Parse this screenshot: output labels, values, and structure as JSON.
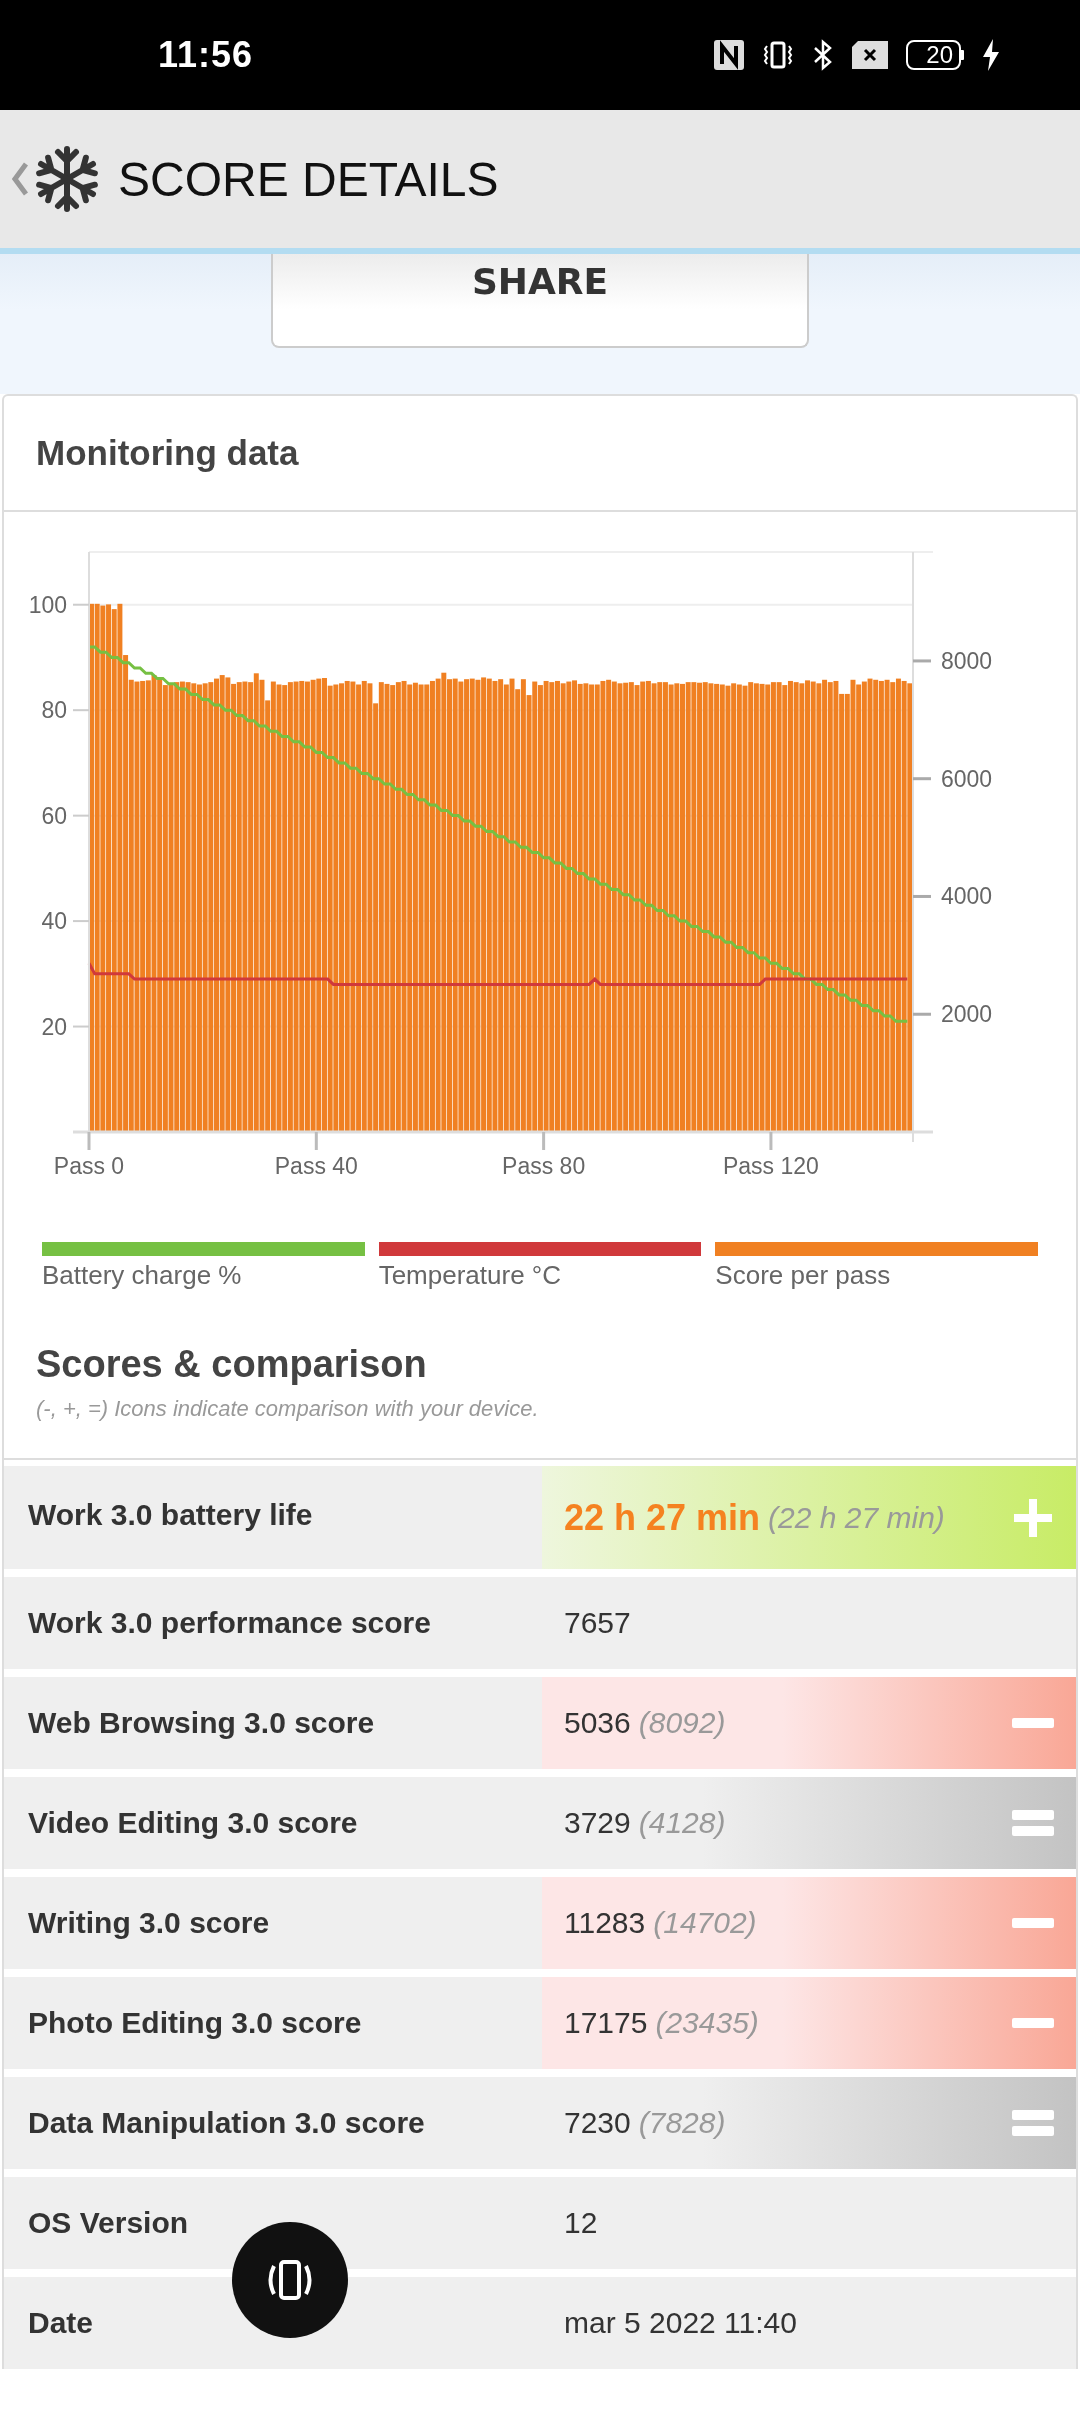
{
  "status_bar": {
    "time": "11:56",
    "battery": "20",
    "charging": true
  },
  "header": {
    "title": "SCORE DETAILS"
  },
  "share_button": {
    "label": "SHARE"
  },
  "monitoring": {
    "title": "Monitoring data",
    "chart_data": {
      "type": "bar",
      "grid": true,
      "categories": [
        "Pass 0",
        null,
        null,
        null,
        null,
        null,
        null,
        null,
        null,
        null,
        null,
        null,
        null,
        null,
        null,
        null,
        null,
        null,
        null,
        null,
        null,
        null,
        null,
        null,
        null,
        null,
        null,
        null,
        null,
        null,
        null,
        null,
        null,
        null,
        null,
        null,
        null,
        null,
        null,
        null,
        "Pass 40",
        null,
        null,
        null,
        null,
        null,
        null,
        null,
        null,
        null,
        null,
        null,
        null,
        null,
        null,
        null,
        null,
        null,
        null,
        null,
        null,
        null,
        null,
        null,
        null,
        null,
        null,
        null,
        null,
        null,
        null,
        null,
        null,
        null,
        null,
        null,
        null,
        null,
        null,
        null,
        "Pass 80",
        null,
        null,
        null,
        null,
        null,
        null,
        null,
        null,
        null,
        null,
        null,
        null,
        null,
        null,
        null,
        null,
        null,
        null,
        null,
        null,
        null,
        null,
        null,
        null,
        null,
        null,
        null,
        null,
        null,
        null,
        null,
        null,
        null,
        null,
        null,
        null,
        null,
        null,
        null,
        "Pass 120",
        null,
        null,
        null,
        null,
        null,
        null,
        null,
        null,
        null,
        null,
        null,
        null,
        null,
        null,
        null,
        null,
        null,
        null,
        null,
        null,
        null,
        null,
        null,
        null
      ],
      "ylim": [
        0,
        110
      ],
      "yticks": [
        20,
        40,
        60,
        80,
        100
      ],
      "y2lim": [
        0,
        9850
      ],
      "y2ticks": [
        2000,
        4000,
        6000,
        8000
      ],
      "series": [
        {
          "name": "Battery charge %",
          "color": "#76c043",
          "type": "line",
          "values": [
            92,
            92,
            91,
            91,
            90,
            90,
            89,
            89,
            88,
            88,
            87,
            87,
            86,
            86,
            85,
            85,
            84,
            84,
            83,
            83,
            82,
            82,
            81,
            81,
            80,
            80,
            79,
            79,
            78,
            78,
            77,
            77,
            76,
            76,
            75,
            75,
            74,
            74,
            73,
            73,
            72,
            72,
            71,
            71,
            70,
            70,
            69,
            69,
            68,
            68,
            67,
            67,
            66,
            66,
            65,
            65,
            64,
            64,
            63,
            63,
            62,
            62,
            61,
            61,
            60,
            60,
            59,
            59,
            58,
            58,
            57,
            57,
            56,
            56,
            55,
            55,
            54,
            54,
            53,
            53,
            52,
            52,
            51,
            51,
            50,
            50,
            49,
            49,
            48,
            48,
            47,
            47,
            46,
            46,
            45,
            45,
            44,
            44,
            43,
            43,
            42,
            42,
            41,
            41,
            40,
            40,
            39,
            39,
            38,
            38,
            37,
            37,
            36,
            36,
            35,
            35,
            34,
            34,
            33,
            33,
            32,
            32,
            31,
            31,
            30,
            30,
            29,
            29,
            28,
            28,
            27,
            27,
            26,
            26,
            25,
            25,
            24,
            24,
            23,
            23,
            22,
            22,
            21,
            21,
            21
          ]
        },
        {
          "name": "Temperature °C",
          "color": "#d0393b",
          "type": "line",
          "values": [
            32,
            30,
            30,
            30,
            30,
            30,
            30,
            30,
            29,
            29,
            29,
            29,
            29,
            29,
            29,
            29,
            29,
            29,
            29,
            29,
            29,
            29,
            29,
            29,
            29,
            29,
            29,
            29,
            29,
            29,
            29,
            29,
            29,
            29,
            29,
            29,
            29,
            29,
            29,
            29,
            29,
            29,
            29,
            28,
            28,
            28,
            28,
            28,
            28,
            28,
            28,
            28,
            28,
            28,
            28,
            28,
            28,
            28,
            28,
            28,
            28,
            28,
            28,
            28,
            28,
            28,
            28,
            28,
            28,
            28,
            28,
            28,
            28,
            28,
            28,
            28,
            28,
            28,
            28,
            28,
            28,
            28,
            28,
            28,
            28,
            28,
            28,
            28,
            28,
            29,
            28,
            28,
            28,
            28,
            28,
            28,
            28,
            28,
            28,
            28,
            28,
            28,
            28,
            28,
            28,
            28,
            28,
            28,
            28,
            28,
            28,
            28,
            28,
            28,
            28,
            28,
            28,
            28,
            28,
            29,
            29,
            29,
            29,
            29,
            29,
            29,
            29,
            29,
            29,
            29,
            29,
            29,
            29,
            29,
            29,
            29,
            29,
            29,
            29,
            29,
            29,
            29,
            29,
            29,
            29
          ]
        },
        {
          "name": "Score per pass",
          "color": "#f08022",
          "type": "bar",
          "axis": "y2",
          "values": [
            8970,
            8970,
            8940,
            8960,
            8880,
            8970,
            8100,
            7680,
            7650,
            7660,
            7670,
            7760,
            7710,
            7590,
            7620,
            7640,
            7650,
            7640,
            7620,
            7600,
            7620,
            7640,
            7700,
            7760,
            7720,
            7610,
            7640,
            7650,
            7640,
            7790,
            7680,
            7330,
            7650,
            7600,
            7590,
            7640,
            7650,
            7660,
            7650,
            7680,
            7700,
            7710,
            7580,
            7600,
            7620,
            7660,
            7650,
            7600,
            7660,
            7620,
            7280,
            7640,
            7610,
            7590,
            7640,
            7660,
            7600,
            7630,
            7600,
            7600,
            7660,
            7700,
            7800,
            7690,
            7700,
            7650,
            7690,
            7700,
            7680,
            7720,
            7700,
            7660,
            7690,
            7600,
            7700,
            7520,
            7690,
            7420,
            7650,
            7590,
            7660,
            7640,
            7660,
            7620,
            7650,
            7670,
            7610,
            7620,
            7600,
            7600,
            7660,
            7680,
            7650,
            7620,
            7630,
            7640,
            7590,
            7650,
            7660,
            7620,
            7640,
            7640,
            7600,
            7620,
            7610,
            7640,
            7640,
            7630,
            7640,
            7620,
            7610,
            7600,
            7580,
            7620,
            7600,
            7580,
            7640,
            7620,
            7610,
            7600,
            7640,
            7640,
            7590,
            7660,
            7640,
            7620,
            7670,
            7650,
            7620,
            7680,
            7640,
            7660,
            7440,
            7440,
            7680,
            7600,
            7650,
            7700,
            7680,
            7660,
            7680,
            7640,
            7700,
            7660,
            7620
          ]
        }
      ]
    }
  },
  "scores": {
    "title": "Scores & comparison",
    "note": "(-, +, =) Icons indicate comparison with your device.",
    "rows": [
      {
        "label": "Work 3.0 battery life",
        "value": "22 h 27 min",
        "reference": "(22 h 27 min)",
        "kind": "plus",
        "highlight": true
      },
      {
        "label": "Work 3.0 performance score",
        "value": "7657",
        "kind": "plain",
        "highlight": false
      },
      {
        "label": "Web Browsing 3.0 score",
        "value": "5036",
        "reference": "(8092)",
        "kind": "minus",
        "highlight": false
      },
      {
        "label": "Video Editing 3.0 score",
        "value": "3729",
        "reference": "(4128)",
        "kind": "equal",
        "highlight": false
      },
      {
        "label": "Writing 3.0 score",
        "value": "11283",
        "reference": "(14702)",
        "kind": "minus",
        "highlight": false
      },
      {
        "label": "Photo Editing 3.0 score",
        "value": "17175",
        "reference": "(23435)",
        "kind": "minus",
        "highlight": false
      },
      {
        "label": "Data Manipulation 3.0 score",
        "value": "7230",
        "reference": "(7828)",
        "kind": "equal",
        "highlight": false
      },
      {
        "label": "OS Version",
        "value": "12",
        "kind": "plain",
        "highlight": false
      },
      {
        "label": "Date",
        "value": "mar 5 2022 11:40",
        "kind": "plain",
        "highlight": false
      }
    ]
  }
}
